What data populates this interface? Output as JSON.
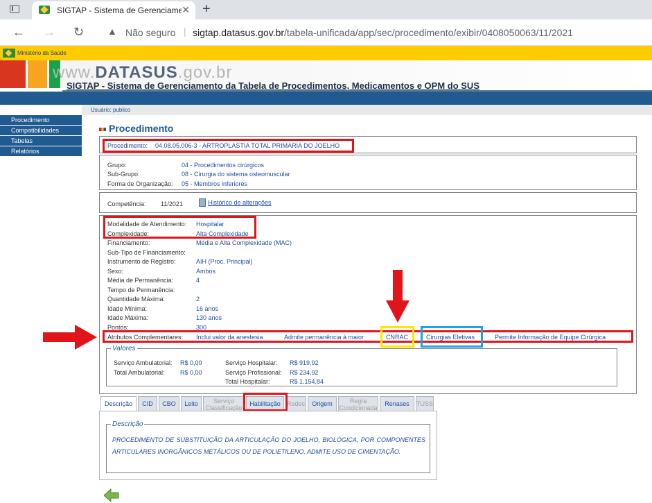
{
  "browser": {
    "tab_title": "SIGTAP - Sistema de Gerenciame",
    "close_glyph": "✕",
    "new_tab_glyph": "+",
    "back_glyph": "←",
    "forward_glyph": "→",
    "reload_glyph": "↻",
    "security_label": "Não seguro",
    "url_host": "sigtap.datasus.gov.br",
    "url_path": "/tabela-unificada/app/sec/procedimento/exibir/0408050063/11/2021"
  },
  "header": {
    "gov_label": "Ministério da Saúde",
    "logo_prefix": "www.",
    "logo_brand": "DATASUS",
    "logo_suffix": ".gov.br",
    "system_title": "SIGTAP - Sistema de Gerenciamento da Tabela de Procedimentos, Medicamentos e OPM do SUS"
  },
  "user": {
    "label": "Usuário:",
    "value": "publico"
  },
  "sidebar": {
    "items": [
      {
        "label": "Procedimento"
      },
      {
        "label": "Compatibilidades"
      },
      {
        "label": "Tabelas"
      },
      {
        "label": "Relatórios"
      }
    ]
  },
  "page": {
    "title": "Procedimento",
    "procedimento_label": "Procedimento:",
    "procedimento_value": "04.08.05.006-3 - ARTROPLASTIA TOTAL PRIMARIA DO JOELHO",
    "grupo": {
      "rows": [
        {
          "label": "Grupo:",
          "value": "04 - Procedimentos cirúrgicos"
        },
        {
          "label": "Sub-Grupo:",
          "value": "08 - Cirurgia do sistema osteomuscular"
        },
        {
          "label": "Forma de Organização:",
          "value": "05 - Membros inferiores"
        }
      ]
    },
    "competencia_label": "Competência:",
    "competencia_value": "11/2021",
    "historico_link": "Histórico de alterações",
    "details": [
      {
        "label": "Modalidade de Atendimento:",
        "value": "Hospitalar"
      },
      {
        "label": "Complexidade:",
        "value": "Alta Complexidade"
      },
      {
        "label": "Financiamento:",
        "value": "Média e Alta Complexidade (MAC)"
      },
      {
        "label": "Sub-Tipo de Financiamento:",
        "value": ""
      },
      {
        "label": "Instrumento de Registro:",
        "value": "AIH (Proc. Principal)"
      },
      {
        "label": "Sexo:",
        "value": "Ambos"
      },
      {
        "label": "Média de Permanência:",
        "value": "4"
      },
      {
        "label": "Tempo de Permanência:",
        "value": ""
      },
      {
        "label": "Quantidade Máxima:",
        "value": "2"
      },
      {
        "label": "Idade Mínima:",
        "value": "16 anos"
      },
      {
        "label": "Idade Máxima:",
        "value": "130 anos"
      },
      {
        "label": "Pontos:",
        "value": "300"
      }
    ],
    "atributos_label": "Atributos Complementares:",
    "atributos": [
      "Inclui valor da anestesia",
      "Admite permanência à maior",
      "CNRAC",
      "Cirurgias Eletivas",
      "Permite Informação de Equipe Cirúrgica"
    ],
    "valores": {
      "legend": "Valores",
      "servico_ambulatorial_label": "Serviço Ambulatorial:",
      "servico_ambulatorial_value": "R$ 0,00",
      "total_ambulatorial_label": "Total Ambulatorial:",
      "total_ambulatorial_value": "R$ 0,00",
      "servico_hospitalar_label": "Serviço Hospitalar:",
      "servico_hospitalar_value": "R$ 919,92",
      "servico_profissional_label": "Serviço Profissional:",
      "servico_profissional_value": "R$ 234,92",
      "total_hospitalar_label": "Total Hospitalar:",
      "total_hospitalar_value": "R$ 1.154,84"
    },
    "tabs": [
      {
        "label": "Descrição"
      },
      {
        "label": "CID"
      },
      {
        "label": "CBO"
      },
      {
        "label": "Leito"
      },
      {
        "label": "Serviço Classificação"
      },
      {
        "label": "Habilitação"
      },
      {
        "label": "Redes"
      },
      {
        "label": "Origem"
      },
      {
        "label": "Regra Condicionada"
      },
      {
        "label": "Renases"
      },
      {
        "label": "TUSS"
      }
    ],
    "descricao": {
      "legend": "Descrição",
      "text": "PROCEDIMENTO DE SUBSTITUIÇÃO DA ARTICULAÇÃO DO JOELHO, BIOLÓGICA, POR COMPONENTES ARTICULARES INORGÂNICOS METÁLICOS OU DE POLIETILENO. ADMITE USO DE CIMENTAÇÃO."
    }
  },
  "colors": {
    "highlight_red": "#e1141b",
    "highlight_yellow": "#ffe600",
    "highlight_blue": "#1aa3e8",
    "nav_blue": "#1f5a91"
  },
  "icons": [
    "tab-strip-icon",
    "favicon-icon",
    "back-arrow-icon",
    "forward-arrow-icon",
    "reload-icon",
    "warning-icon",
    "history-icon",
    "red-arrow-icon",
    "green-back-arrow-icon"
  ]
}
